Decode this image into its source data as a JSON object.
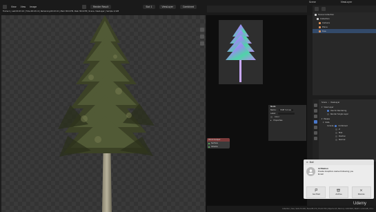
{
  "topbar": {
    "left_menu": [
      "View",
      "View",
      "Image"
    ],
    "render_slot": "Render Result",
    "slot_label": "Slot 1",
    "view_layer": "ViewLayer",
    "combined": "Combined",
    "compositor_mode": "Closed",
    "scene": "Scene",
    "view_layer_right": "ViewLayer",
    "frame_info": "Frame:1 | Last:00:43.10 | Time:00:43.10 | Remaining:00:43.10 | Mem:304.97M, Peak 304.97M | Scene, ViewLayer | Sample 1/128"
  },
  "outliner": {
    "header": "Scene Collection",
    "items": [
      {
        "label": "Collection",
        "color": "#cfcfcf"
      },
      {
        "label": "Camera",
        "color": "#e0955c"
      },
      {
        "label": "Plane",
        "color": "#e0955c"
      },
      {
        "label": "tree",
        "color": "#e0955c"
      }
    ]
  },
  "nodes": {
    "render_node": {
      "title": "Render Layers",
      "rows": [
        "Scene",
        "ViewLayer",
        "Image",
        "Alpha",
        "Noisy Image"
      ]
    },
    "output_node": {
      "title": "World Output",
      "rows": [
        "Surface",
        "Volume"
      ]
    }
  },
  "node_panel": {
    "title": "Node",
    "name_label": "Name:",
    "name_value": "RGB Curves",
    "label_label": "Label:",
    "color_label": "Color",
    "properties_label": "Properties"
  },
  "properties": {
    "scene": "Scene",
    "view_layer": "ViewLayer",
    "view_layer_section": "View Layer",
    "use_for_rendering": "Use for Rendering",
    "render_single_layer": "Render Single Layer",
    "passes": "Passes",
    "data": "Data",
    "include_label": "Include",
    "combined": "Combined",
    "z": "Z",
    "mist": "Mist",
    "position": "Position",
    "normal": "Normal"
  },
  "statusbar": {
    "text": "Collection | tree | Verts:79,318 | Faces:85,179 | Tris:67,760 | Objects:1/3 | Memory: 118.8 MiB | VRAM: 1.1/4.0 GiB | 3.5.1"
  },
  "notification": {
    "app": "Mail",
    "title": "ArtStation",
    "message": "Panda Graphics started following you",
    "message_suffix": "Email",
    "actions": [
      "Get Paid",
      "Archive",
      "Dismiss"
    ]
  },
  "watermark": "Udemy"
}
